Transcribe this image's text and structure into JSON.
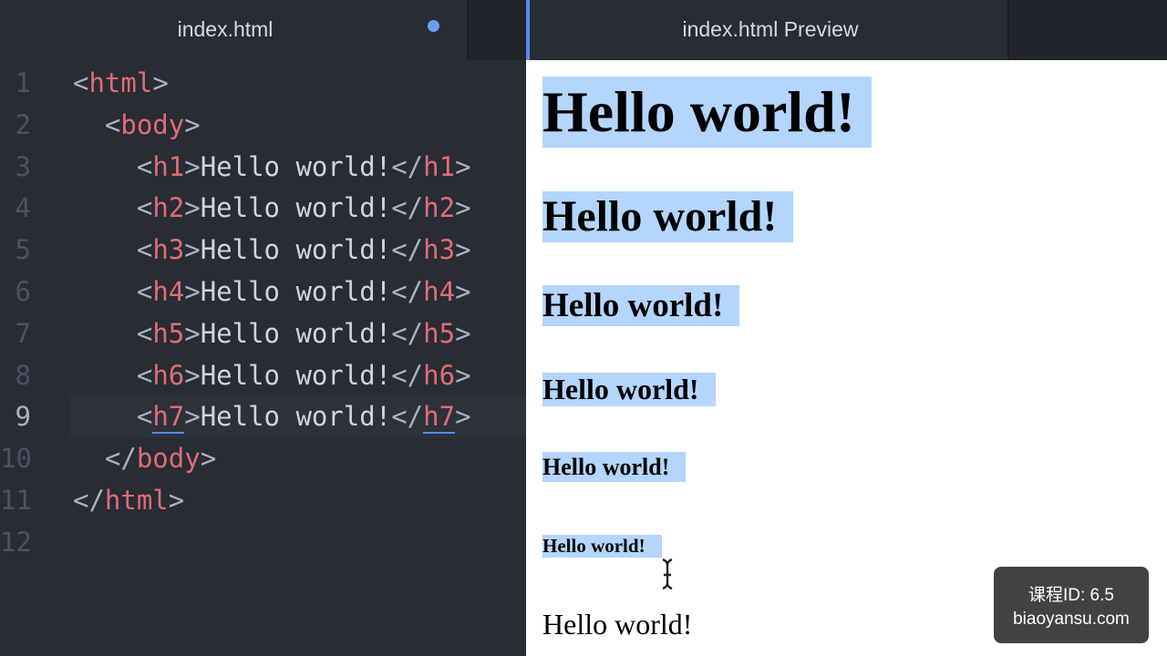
{
  "editor": {
    "tab_title": "index.html",
    "lines": [
      {
        "num": "1",
        "indent": "",
        "parts": [
          [
            "punc",
            "<"
          ],
          [
            "tag",
            "html"
          ],
          [
            "punc",
            ">"
          ]
        ]
      },
      {
        "num": "2",
        "indent": "  ",
        "parts": [
          [
            "punc",
            "<"
          ],
          [
            "tag",
            "body"
          ],
          [
            "punc",
            ">"
          ]
        ]
      },
      {
        "num": "3",
        "indent": "    ",
        "parts": [
          [
            "punc",
            "<"
          ],
          [
            "tag",
            "h1"
          ],
          [
            "punc",
            ">"
          ],
          [
            "txt",
            "Hello world!"
          ],
          [
            "punc",
            "</"
          ],
          [
            "tag",
            "h1"
          ],
          [
            "punc",
            ">"
          ]
        ]
      },
      {
        "num": "4",
        "indent": "    ",
        "parts": [
          [
            "punc",
            "<"
          ],
          [
            "tag",
            "h2"
          ],
          [
            "punc",
            ">"
          ],
          [
            "txt",
            "Hello world!"
          ],
          [
            "punc",
            "</"
          ],
          [
            "tag",
            "h2"
          ],
          [
            "punc",
            ">"
          ]
        ]
      },
      {
        "num": "5",
        "indent": "    ",
        "parts": [
          [
            "punc",
            "<"
          ],
          [
            "tag",
            "h3"
          ],
          [
            "punc",
            ">"
          ],
          [
            "txt",
            "Hello world!"
          ],
          [
            "punc",
            "</"
          ],
          [
            "tag",
            "h3"
          ],
          [
            "punc",
            ">"
          ]
        ]
      },
      {
        "num": "6",
        "indent": "    ",
        "parts": [
          [
            "punc",
            "<"
          ],
          [
            "tag",
            "h4"
          ],
          [
            "punc",
            ">"
          ],
          [
            "txt",
            "Hello world!"
          ],
          [
            "punc",
            "</"
          ],
          [
            "tag",
            "h4"
          ],
          [
            "punc",
            ">"
          ]
        ]
      },
      {
        "num": "7",
        "indent": "    ",
        "parts": [
          [
            "punc",
            "<"
          ],
          [
            "tag",
            "h5"
          ],
          [
            "punc",
            ">"
          ],
          [
            "txt",
            "Hello world!"
          ],
          [
            "punc",
            "</"
          ],
          [
            "tag",
            "h5"
          ],
          [
            "punc",
            ">"
          ]
        ]
      },
      {
        "num": "8",
        "indent": "    ",
        "parts": [
          [
            "punc",
            "<"
          ],
          [
            "tag",
            "h6"
          ],
          [
            "punc",
            ">"
          ],
          [
            "txt",
            "Hello world!"
          ],
          [
            "punc",
            "</"
          ],
          [
            "tag",
            "h6"
          ],
          [
            "punc",
            ">"
          ]
        ]
      },
      {
        "num": "9",
        "indent": "    ",
        "current": true,
        "parts": [
          [
            "punc",
            "<"
          ],
          [
            "tag-ul",
            "h7"
          ],
          [
            "punc",
            ">"
          ],
          [
            "txt",
            "Hello world!"
          ],
          [
            "punc",
            "</"
          ],
          [
            "tag-ul",
            "h7"
          ],
          [
            "punc",
            ">"
          ]
        ]
      },
      {
        "num": "10",
        "indent": "  ",
        "parts": [
          [
            "punc",
            "</"
          ],
          [
            "tag",
            "body"
          ],
          [
            "punc",
            ">"
          ]
        ]
      },
      {
        "num": "11",
        "indent": "",
        "parts": [
          [
            "punc",
            "</"
          ],
          [
            "tag",
            "html"
          ],
          [
            "punc",
            ">"
          ]
        ]
      },
      {
        "num": "12",
        "indent": "",
        "parts": []
      }
    ]
  },
  "preview": {
    "tab_title": "index.html Preview",
    "headings": [
      {
        "text": "Hello world!",
        "level": "h1"
      },
      {
        "text": "Hello world!",
        "level": "h2"
      },
      {
        "text": "Hello world!",
        "level": "h3"
      },
      {
        "text": "Hello world!",
        "level": "h4"
      },
      {
        "text": "Hello world!",
        "level": "h5"
      },
      {
        "text": "Hello world!",
        "level": "h6"
      },
      {
        "text": "Hello world!",
        "level": "h7"
      }
    ]
  },
  "watermark": {
    "line1": "课程ID: 6.5",
    "line2": "biaoyansu.com"
  },
  "colors": {
    "tag": "#e06c75",
    "selection": "#b4d5fe",
    "accent": "#568af2"
  }
}
